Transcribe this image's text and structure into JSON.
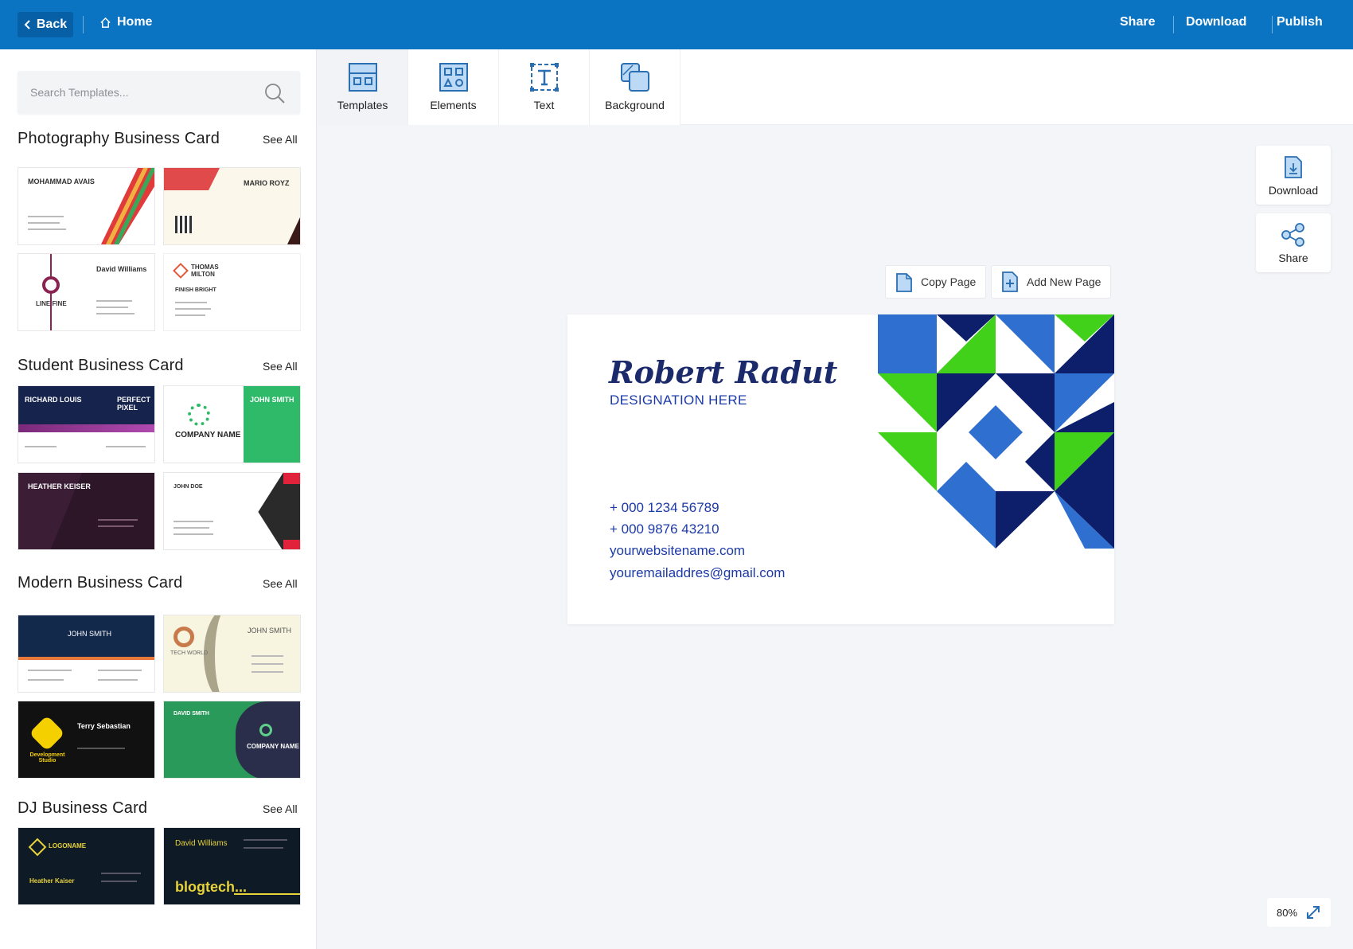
{
  "topbar": {
    "back_label": "Back",
    "home_label": "Home",
    "share_label": "Share",
    "download_label": "Download",
    "publish_label": "Publish"
  },
  "sidebar": {
    "search_placeholder": "Search Templates...",
    "categories": [
      {
        "title": "Photography Business Card",
        "see_all": "See All",
        "thumbs": [
          {
            "name": "MOHAMMAD AVAIS"
          },
          {
            "name": "MARIO ROYZ"
          },
          {
            "name": "David Williams",
            "logo": "LINE FINE"
          },
          {
            "name": "FINISH BRIGHT",
            "sub": "THOMAS MILTON"
          }
        ]
      },
      {
        "title": "Student Business Card",
        "see_all": "See All",
        "thumbs": [
          {
            "name": "RICHARD LOUIS",
            "logo": "PERFECT PIXEL"
          },
          {
            "name": "JOHN SMITH",
            "logo": "COMPANY NAME"
          },
          {
            "name": "HEATHER KEISER"
          },
          {
            "name": "JOHN DOE"
          }
        ]
      },
      {
        "title": "Modern Business Card",
        "see_all": "See All",
        "thumbs": [
          {
            "name": "JOHN SMITH"
          },
          {
            "name": "JOHN SMITH",
            "logo": "TECH WORLD"
          },
          {
            "name": "Terry Sebastian",
            "logo": "Development Studio"
          },
          {
            "name": "DAVID SMITH",
            "logo": "COMPANY NAME"
          }
        ]
      },
      {
        "title": "DJ Business Card",
        "see_all": "See All",
        "thumbs": [
          {
            "name": "Heather Kaiser",
            "logo": "LOGONAME"
          },
          {
            "name": "David Williams",
            "logo": "blogtech..."
          }
        ]
      }
    ]
  },
  "toolbar": {
    "tabs": [
      {
        "label": "Templates",
        "icon": "templates-icon"
      },
      {
        "label": "Elements",
        "icon": "elements-icon"
      },
      {
        "label": "Text",
        "icon": "text-icon"
      },
      {
        "label": "Background",
        "icon": "background-icon"
      }
    ]
  },
  "side_actions": {
    "download_label": "Download",
    "share_label": "Share"
  },
  "page_actions": {
    "copy_label": "Copy Page",
    "add_label": "Add New Page"
  },
  "card": {
    "name": "Robert Radut",
    "designation": "DESIGNATION HERE",
    "phone1": "+ 000 1234 56789",
    "phone2": "+ 000 9876 43210",
    "website": "yourwebsitename.com",
    "email": "youremailaddres@gmail.com",
    "colors": {
      "navy": "#0d1f6b",
      "blue": "#2e6fd0",
      "green": "#42d11a",
      "white": "#ffffff"
    }
  },
  "zoom": {
    "level": "80%"
  },
  "colors": {
    "topbar": "#0a73c2",
    "accent": "#1c3aa8"
  }
}
